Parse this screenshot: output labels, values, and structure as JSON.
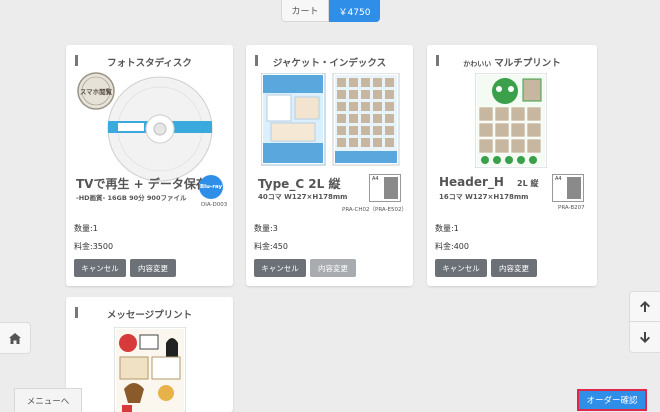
{
  "topbar": {
    "cart_label": "カート",
    "total_label": "￥4750"
  },
  "cards": [
    {
      "title": "フォトスタディスク",
      "product_name": "TVで再生 + データ保存",
      "product_sub": "-HD画質- 16GB 90分 900ファイル",
      "badge": "スマホ閲覧",
      "disc_label": "Blu-ray",
      "code": "DIA-D003",
      "qty": "数量:1",
      "price": "料金:3500",
      "cancel": "キャンセル",
      "change": "内容変更"
    },
    {
      "title": "ジャケット・インデックス",
      "product_name": "Type_C 2L 縦",
      "product_sub": "40コマ W127×H178mm",
      "paper": "A4",
      "code": "PRA-CH02（PRA-E502）",
      "qty": "数量:3",
      "price": "料金:450",
      "cancel": "キャンセル",
      "change": "内容変更"
    },
    {
      "title_small": "かわいい",
      "title": "マルチプリント",
      "product_name": "Header_H",
      "product_size": "2L 縦",
      "product_sub": "16コマ W127×H178mm",
      "paper": "A4",
      "code": "PRA-B207",
      "qty": "数量:1",
      "price": "料金:400",
      "cancel": "キャンセル",
      "change": "内容変更"
    },
    {
      "title": "メッセージプリント"
    }
  ],
  "nav": {
    "menu_label": "メニューへ",
    "order_label": "オーダー確認"
  },
  "colors": {
    "accent": "#2f8fe8",
    "order_border": "#e0284a",
    "button": "#6c7178"
  }
}
